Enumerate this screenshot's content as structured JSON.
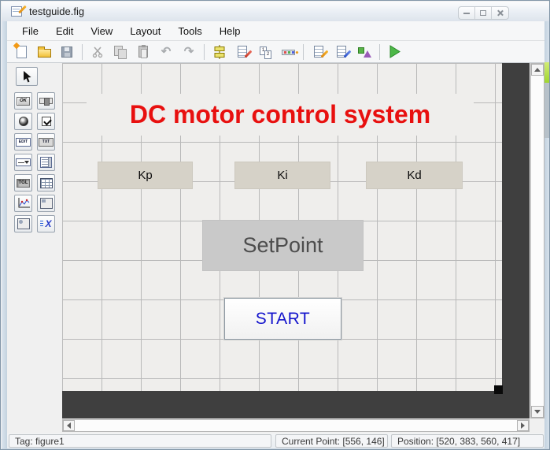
{
  "window": {
    "title": "testguide.fig",
    "controls": [
      {
        "name": "minimize"
      },
      {
        "name": "maximize"
      },
      {
        "name": "close"
      }
    ]
  },
  "menu": {
    "items": [
      {
        "label": "File"
      },
      {
        "label": "Edit"
      },
      {
        "label": "View"
      },
      {
        "label": "Layout"
      },
      {
        "label": "Tools"
      },
      {
        "label": "Help"
      }
    ]
  },
  "toolbar": {
    "icons": [
      {
        "name": "new-figure",
        "enabled": true
      },
      {
        "name": "open-figure",
        "enabled": true
      },
      {
        "name": "save-figure",
        "enabled": false
      },
      {
        "name": "cut",
        "enabled": false
      },
      {
        "name": "copy",
        "enabled": false
      },
      {
        "name": "paste",
        "enabled": false
      },
      {
        "name": "undo",
        "enabled": false
      },
      {
        "name": "redo",
        "enabled": false
      },
      {
        "name": "align-objects",
        "enabled": true
      },
      {
        "name": "menu-editor",
        "enabled": true
      },
      {
        "name": "tab-order-editor",
        "enabled": true
      },
      {
        "name": "toolbar-editor",
        "enabled": true
      },
      {
        "name": "editor",
        "enabled": true
      },
      {
        "name": "property-inspector",
        "enabled": true
      },
      {
        "name": "object-browser",
        "enabled": true
      },
      {
        "name": "run",
        "enabled": true
      }
    ]
  },
  "palette": {
    "items": [
      {
        "name": "select"
      },
      {
        "name": "push-button"
      },
      {
        "name": "slider"
      },
      {
        "name": "radio-button"
      },
      {
        "name": "check-box"
      },
      {
        "name": "edit-text"
      },
      {
        "name": "static-text"
      },
      {
        "name": "pop-up-menu"
      },
      {
        "name": "listbox"
      },
      {
        "name": "toggle-button"
      },
      {
        "name": "table"
      },
      {
        "name": "axes"
      },
      {
        "name": "panel"
      },
      {
        "name": "button-group"
      },
      {
        "name": "activex-control"
      }
    ],
    "glyphs": {
      "ok": "OK",
      "edit": "EDIT",
      "txt": "TXT",
      "tgl": "TGL",
      "x": "X",
      "one": "1",
      "two": "2"
    }
  },
  "canvas": {
    "title": "DC motor control system",
    "title_color": "#e8100f",
    "fields": [
      {
        "label": "Kp"
      },
      {
        "label": "Ki"
      },
      {
        "label": "Kd"
      }
    ],
    "setpoint_label": "SetPoint",
    "start_label": "START",
    "start_color": "#1414cc",
    "run_green": "#3fae3f"
  },
  "statusbar": {
    "tag": "Tag: figure1",
    "current_point": "Current Point: [556, 146]",
    "position": "Position: [520, 383, 560, 417]"
  }
}
